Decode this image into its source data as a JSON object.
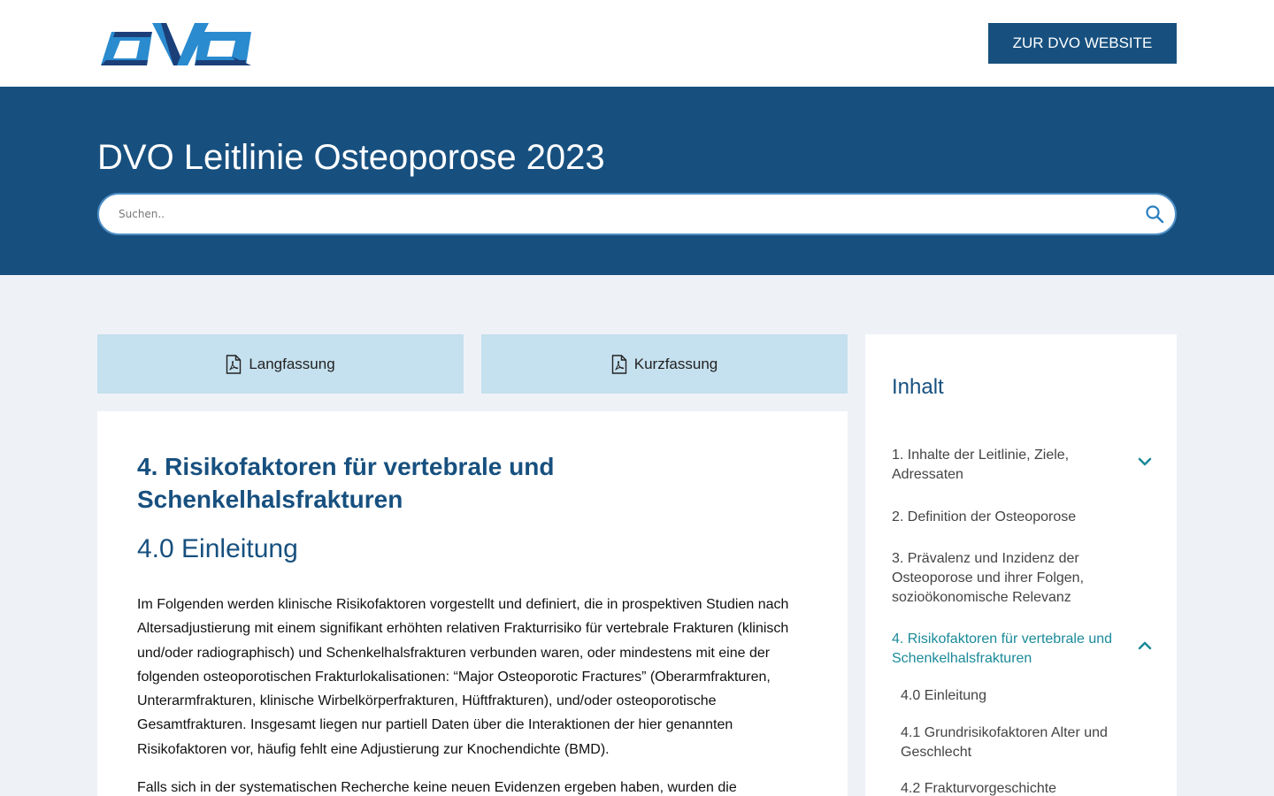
{
  "header": {
    "logo_text": "DVO",
    "site_button": "ZUR DVO WEBSITE"
  },
  "hero": {
    "title": "DVO Leitlinie Osteoporose 2023",
    "search_placeholder": "Suchen.."
  },
  "downloads": {
    "long_label": "Langfassung",
    "short_label": "Kurzfassung"
  },
  "article": {
    "chapter_heading": "4. Risikofaktoren für vertebrale und Schenkelhalsfrakturen",
    "section_heading": "4.0 Einleitung",
    "paragraph_1": "Im Folgenden werden klinische Risikofaktoren vorgestellt und definiert, die in prospektiven Studien nach Altersadjustierung mit einem signifikant erhöhten relativen Frakturrisiko für vertebrale Frakturen (klinisch und/oder radiographisch) und Schenkelhalsfrakturen verbunden waren, oder mindestens mit eine der folgenden osteoporotischen Frakturlokalisationen: “Major Osteoporotic Fractures” (Oberarmfrakturen, Unterarmfrakturen, klinische Wirbelkörperfrakturen, Hüftfrakturen), und/oder osteoporotische Gesamtfrakturen. Insgesamt liegen nur partiell Daten über die Interaktionen der hier genannten Risikofaktoren vor, häufig fehlt eine Adjustierung zur Knochendichte (BMD).",
    "paragraph_2": "Falls sich in der systematischen Recherche keine neuen Evidenzen ergeben haben, wurden die"
  },
  "toc": {
    "title": "Inhalt",
    "items": [
      {
        "label": "1. Inhalte der Leitlinie, Ziele, Adressaten",
        "expanded": false
      },
      {
        "label": "2. Definition der Osteoporose"
      },
      {
        "label": "3. Prävalenz und Inzidenz der Osteoporose und ihrer Folgen, sozioökonomische Relevanz"
      },
      {
        "label": "4. Risikofaktoren für vertebrale und Schenkelhalsfrakturen",
        "expanded": true,
        "active": true
      }
    ],
    "subitems": [
      {
        "label": "4.0 Einleitung"
      },
      {
        "label": "4.1 Grundrisikofaktoren Alter und Geschlecht"
      },
      {
        "label": "4.2 Frakturvorgeschichte"
      }
    ]
  },
  "colors": {
    "brand_blue": "#17507f",
    "active_teal": "#1a8a99",
    "pdf_button_bg": "#c5e0ee",
    "page_bg": "#eef2f7"
  },
  "icons": {
    "search": "search-icon",
    "pdf": "pdf-file-icon",
    "expand": "chevron-down-icon",
    "collapse": "chevron-up-icon"
  }
}
